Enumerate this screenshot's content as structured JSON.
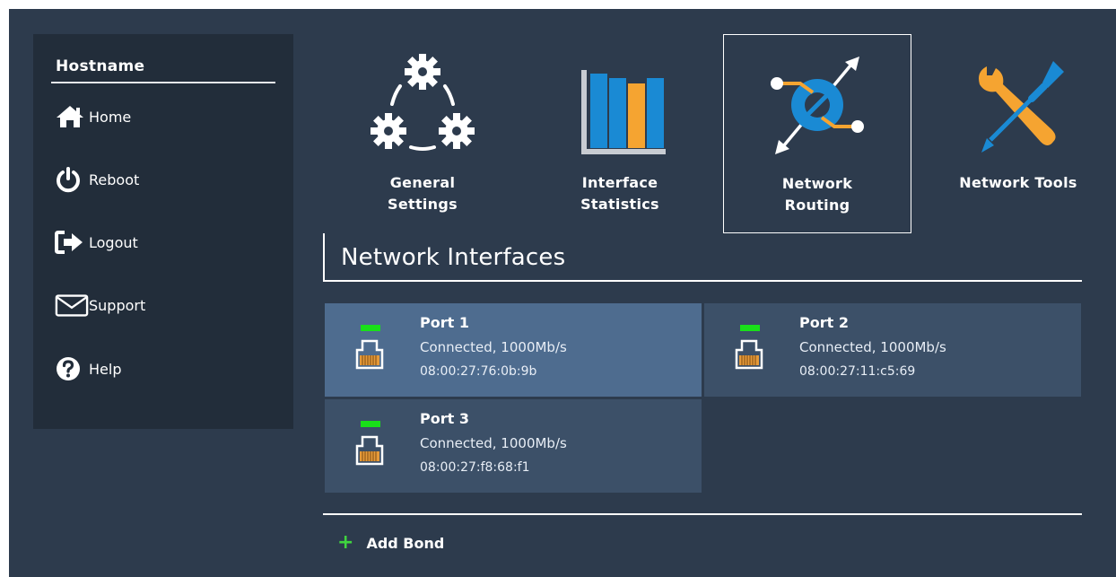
{
  "sidebar": {
    "title": "Hostname",
    "items": [
      {
        "label": "Home",
        "icon": "home-icon"
      },
      {
        "label": "Reboot",
        "icon": "power-icon"
      },
      {
        "label": "Logout",
        "icon": "logout-icon"
      },
      {
        "label": "Support",
        "icon": "mail-icon"
      },
      {
        "label": "Help",
        "icon": "help-icon"
      }
    ]
  },
  "tiles": [
    {
      "label": "General\nSettings",
      "icon": "gears-icon"
    },
    {
      "label": "Interface\nStatistics",
      "icon": "bar-chart-icon"
    },
    {
      "label": "Network\nRouting",
      "icon": "routing-icon",
      "active": true
    },
    {
      "label": "Network Tools",
      "icon": "tools-icon"
    }
  ],
  "section": {
    "title": "Network Interfaces"
  },
  "ports": [
    {
      "name": "Port 1",
      "status": "Connected, 1000Mb/s",
      "mac": "08:00:27:76:0b:9b",
      "selected": true
    },
    {
      "name": "Port 2",
      "status": "Connected, 1000Mb/s",
      "mac": "08:00:27:11:c5:69"
    },
    {
      "name": "Port 3",
      "status": "Connected, 1000Mb/s",
      "mac": "08:00:27:f8:68:f1"
    }
  ],
  "add_bond": {
    "label": "Add Bond"
  },
  "colors": {
    "background": "#2d3b4d",
    "sidebar": "#222d3a",
    "card": "#3c5068",
    "card_selected": "#4e6c8f",
    "led": "#19e019",
    "accent_orange": "#f5a431",
    "accent_blue": "#1a8ad4"
  }
}
